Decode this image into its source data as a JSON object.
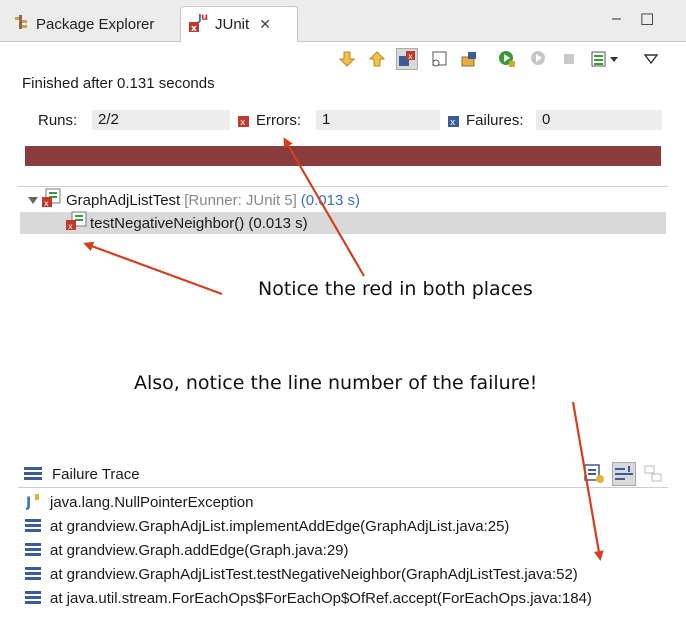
{
  "tabs": {
    "package_explorer": "Package Explorer",
    "junit": "JUnit",
    "close_glyph": "✕"
  },
  "window_controls": {
    "minimize": "–",
    "maximize": "☐"
  },
  "status": {
    "finished": "Finished after 0.131 seconds"
  },
  "counters": {
    "runs_label": "Runs:",
    "runs_value": "2/2",
    "errors_label": "Errors:",
    "errors_value": "1",
    "failures_label": "Failures:",
    "failures_value": "0"
  },
  "progress": {
    "color": "#8b3b3b",
    "fraction": 1.0
  },
  "tree": {
    "suite_name": "GraphAdjListTest",
    "suite_runner": "[Runner: JUnit 5]",
    "suite_time": "(0.013 s)",
    "test_name": "testNegativeNeighbor() (0.013 s)"
  },
  "annotations": {
    "red_note": "Notice the red  in both places",
    "line_note": "Also, notice the line number of the failure!"
  },
  "trace": {
    "title": "Failure Trace",
    "lines": [
      "java.lang.NullPointerException",
      "at grandview.GraphAdjList.implementAddEdge(GraphAdjList.java:25)",
      "at grandview.Graph.addEdge(Graph.java:29)",
      "at grandview.GraphAdjListTest.testNegativeNeighbor(GraphAdjListTest.java:52)",
      "at java.util.stream.ForEachOps$ForEachOp$OfRef.accept(ForEachOps.java:184)"
    ]
  },
  "colors": {
    "accent_arrow": "#d2401f",
    "error_red": "#c0392b",
    "time_blue": "#3c6fae"
  }
}
